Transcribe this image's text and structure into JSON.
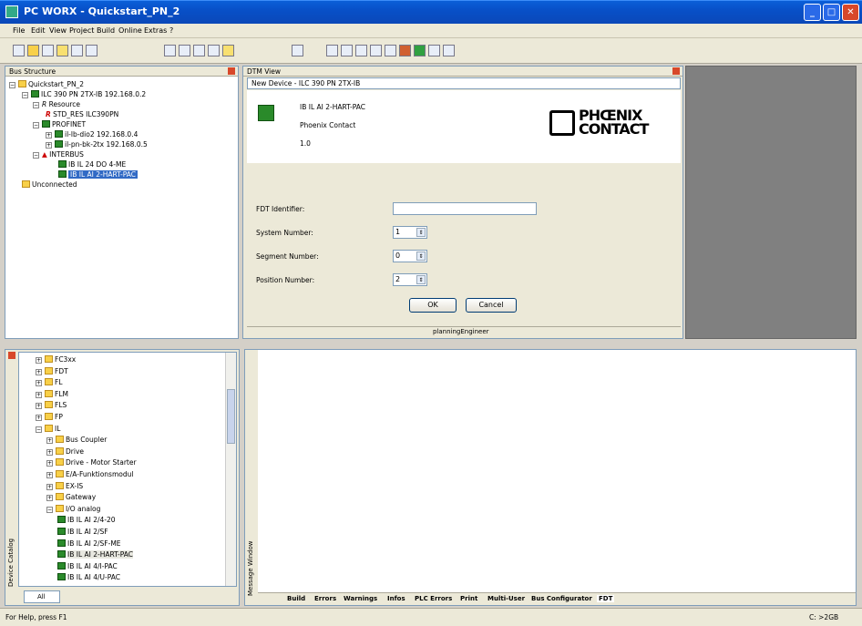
{
  "window": {
    "title": "PC WORX - Quickstart_PN_2"
  },
  "menu": [
    "File",
    "Edit",
    "View",
    "Project",
    "Build",
    "Online",
    "Extras",
    "?"
  ],
  "bus_structure": {
    "title": "Bus Structure",
    "nodes": [
      "Quickstart_PN_2",
      "ILC 390 PN 2TX-IB 192.168.0.2",
      "Resource",
      "STD_RES ILC390PN",
      "PROFINET",
      "il-lb-dio2 192.168.0.4",
      "il-pn-bk-2tx 192.168.0.5",
      "INTERBUS",
      "IB IL 24 DO 4-ME",
      "IB IL AI 2-HART-PAC",
      "Unconnected"
    ]
  },
  "dtm": {
    "title": "DTM View",
    "tab": "New Device - ILC 390 PN 2TX-IB",
    "device_name": "IB IL AI 2-HART-PAC",
    "vendor": "Phoenix Contact",
    "version": "1.0",
    "logo_line1": "PHŒNIX",
    "logo_line2": "CONTACT",
    "fdt_label": "FDT Identifier:",
    "fdt_value": "",
    "system_label": "System Number:",
    "system_value": "1",
    "segment_label": "Segment Number:",
    "segment_value": "0",
    "position_label": "Position Number:",
    "position_value": "2",
    "ok": "OK",
    "cancel": "Cancel",
    "status_user": "planningEngineer"
  },
  "catalog": {
    "side_label": "Device Catalog",
    "all_tab": "All",
    "items": [
      "FC3xx",
      "FDT",
      "FL",
      "FLM",
      "FLS",
      "FP",
      "IL",
      "Bus Coupler",
      "Drive",
      "Drive - Motor Starter",
      "E/A-Funktionsmodul",
      "EX-IS",
      "Gateway",
      "I/O analog",
      "IB IL AI 2/4-20",
      "IB IL AI 2/SF",
      "IB IL AI 2/SF-ME",
      "IB IL AI 2-HART-PAC",
      "IB IL AI 4/I-PAC",
      "IB IL AI 4/U-PAC"
    ]
  },
  "message_window": {
    "side_label": "Message Window",
    "tabs": [
      "Build",
      "Errors",
      "Warnings",
      "Infos",
      "PLC Errors",
      "Print",
      "Multi-User",
      "Bus Configurator",
      "FDT"
    ]
  },
  "status": {
    "help": "For Help, press F1",
    "disk": "C: >2GB"
  }
}
